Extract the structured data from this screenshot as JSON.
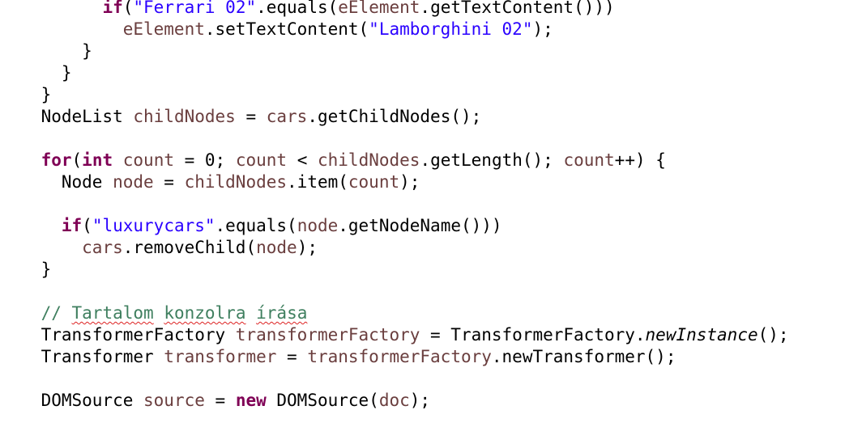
{
  "editor": {
    "lines": [
      {
        "indent": "          ",
        "tokens": [
          {
            "t": "if",
            "c": "kw"
          },
          {
            "t": "("
          },
          {
            "t": "\"Ferrari 02\"",
            "c": "str"
          },
          {
            "t": ".equals("
          },
          {
            "t": "eElement",
            "c": "var"
          },
          {
            "t": ".getTextContent()))"
          }
        ]
      },
      {
        "indent": "            ",
        "tokens": [
          {
            "t": "eElement",
            "c": "var"
          },
          {
            "t": ".setTextContent("
          },
          {
            "t": "\"Lamborghini 02\"",
            "c": "str"
          },
          {
            "t": ");"
          }
        ]
      },
      {
        "indent": "        ",
        "tokens": [
          {
            "t": "}"
          }
        ]
      },
      {
        "indent": "      ",
        "tokens": [
          {
            "t": "}"
          }
        ]
      },
      {
        "indent": "    ",
        "tokens": [
          {
            "t": "}"
          }
        ]
      },
      {
        "indent": "    ",
        "tokens": [
          {
            "t": "NodeList "
          },
          {
            "t": "childNodes",
            "c": "var"
          },
          {
            "t": " = "
          },
          {
            "t": "cars",
            "c": "var"
          },
          {
            "t": ".getChildNodes();"
          }
        ]
      },
      {
        "indent": "",
        "tokens": []
      },
      {
        "indent": "    ",
        "tokens": [
          {
            "t": "for",
            "c": "kw"
          },
          {
            "t": "("
          },
          {
            "t": "int",
            "c": "kw"
          },
          {
            "t": " "
          },
          {
            "t": "count",
            "c": "var"
          },
          {
            "t": " = 0; "
          },
          {
            "t": "count",
            "c": "var"
          },
          {
            "t": " < "
          },
          {
            "t": "childNodes",
            "c": "var"
          },
          {
            "t": ".getLength(); "
          },
          {
            "t": "count",
            "c": "var"
          },
          {
            "t": "++) {"
          }
        ]
      },
      {
        "indent": "      ",
        "tokens": [
          {
            "t": "Node "
          },
          {
            "t": "node",
            "c": "var"
          },
          {
            "t": " = "
          },
          {
            "t": "childNodes",
            "c": "var"
          },
          {
            "t": ".item("
          },
          {
            "t": "count",
            "c": "var"
          },
          {
            "t": ");"
          }
        ]
      },
      {
        "indent": "",
        "tokens": []
      },
      {
        "indent": "      ",
        "tokens": [
          {
            "t": "if",
            "c": "kw"
          },
          {
            "t": "("
          },
          {
            "t": "\"luxurycars\"",
            "c": "str"
          },
          {
            "t": ".equals("
          },
          {
            "t": "node",
            "c": "var"
          },
          {
            "t": ".getNodeName()))"
          }
        ]
      },
      {
        "indent": "        ",
        "tokens": [
          {
            "t": "cars",
            "c": "var"
          },
          {
            "t": ".removeChild("
          },
          {
            "t": "node",
            "c": "var"
          },
          {
            "t": ");"
          }
        ]
      },
      {
        "indent": "    ",
        "tokens": [
          {
            "t": "}"
          }
        ]
      },
      {
        "indent": "",
        "tokens": []
      },
      {
        "indent": "    ",
        "tokens": [
          {
            "t": "// ",
            "c": "cm"
          },
          {
            "t": "Tartalom",
            "c": "cm sq"
          },
          {
            "t": " ",
            "c": "cm"
          },
          {
            "t": "konzolra",
            "c": "cm sq"
          },
          {
            "t": " ",
            "c": "cm"
          },
          {
            "t": "írása",
            "c": "cm sq"
          }
        ]
      },
      {
        "indent": "    ",
        "tokens": [
          {
            "t": "TransformerFactory "
          },
          {
            "t": "transformerFactory",
            "c": "var"
          },
          {
            "t": " = TransformerFactory."
          },
          {
            "t": "newInstance",
            "c": "it"
          },
          {
            "t": "();"
          }
        ]
      },
      {
        "indent": "    ",
        "tokens": [
          {
            "t": "Transformer "
          },
          {
            "t": "transformer",
            "c": "var"
          },
          {
            "t": " = "
          },
          {
            "t": "transformerFactory",
            "c": "var"
          },
          {
            "t": ".newTransformer();"
          }
        ]
      },
      {
        "indent": "",
        "tokens": []
      },
      {
        "indent": "    ",
        "tokens": [
          {
            "t": "DOMSource "
          },
          {
            "t": "source",
            "c": "var"
          },
          {
            "t": " = "
          },
          {
            "t": "new",
            "c": "kw"
          },
          {
            "t": " DOMSource("
          },
          {
            "t": "doc",
            "c": "var"
          },
          {
            "t": ");"
          }
        ]
      }
    ]
  }
}
